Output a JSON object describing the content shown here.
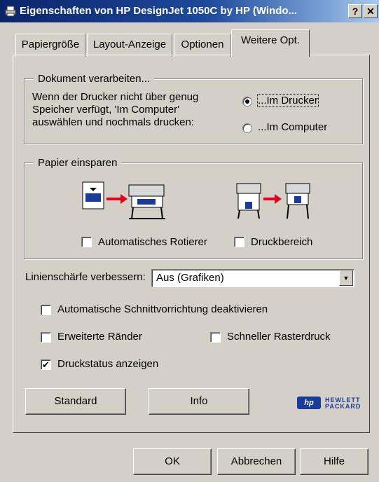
{
  "window": {
    "title": "Eigenschaften von HP DesignJet 1050C by HP (Windo...",
    "help_label": "?",
    "close_label": "✕"
  },
  "tabs": [
    {
      "label": "Papiergröße",
      "active": false
    },
    {
      "label": "Layout-Anzeige",
      "active": false
    },
    {
      "label": "Optionen",
      "active": false
    },
    {
      "label": "Weitere Opt.",
      "active": true
    }
  ],
  "dokument": {
    "legend": "Dokument verarbeiten...",
    "desc_lines": [
      "Wenn der Drucker nicht über genug",
      "Speicher verfügt, 'Im Computer'",
      "auswählen und nochmals drucken:"
    ],
    "options": [
      {
        "label": "...Im Drucker",
        "selected": true
      },
      {
        "label": "...Im Computer",
        "selected": false
      }
    ]
  },
  "papier": {
    "legend": "Papier einsparen",
    "auto_rotate": {
      "label": "Automatisches Rotierer",
      "checked": false
    },
    "druckbereich": {
      "label": "Druckbereich",
      "checked": false
    }
  },
  "linien": {
    "label": "Linienschärfe verbessern:",
    "value": "Aus (Grafiken)"
  },
  "checks": {
    "schnitt": {
      "label": "Automatische Schnittvorrichtung deaktivieren",
      "checked": false
    },
    "raender": {
      "label": "Erweiterte Ränder",
      "checked": false
    },
    "raster": {
      "label": "Schneller Rasterdruck",
      "checked": false
    },
    "status": {
      "label": "Druckstatus anzeigen",
      "checked": true
    }
  },
  "buttons": {
    "standard": "Standard",
    "info": "Info",
    "ok": "OK",
    "abbrechen": "Abbrechen",
    "hilfe": "Hilfe"
  },
  "logo": {
    "line1": "HEWLETT",
    "line2": "PACKARD",
    "mark": "hp"
  },
  "check_glyph": "✔",
  "colors": {
    "title_start": "#0a246a",
    "title_end": "#a6caf0",
    "face": "#d4d0c8",
    "arrow": "#e3001b",
    "doc_mark": "#1a3b9a"
  }
}
